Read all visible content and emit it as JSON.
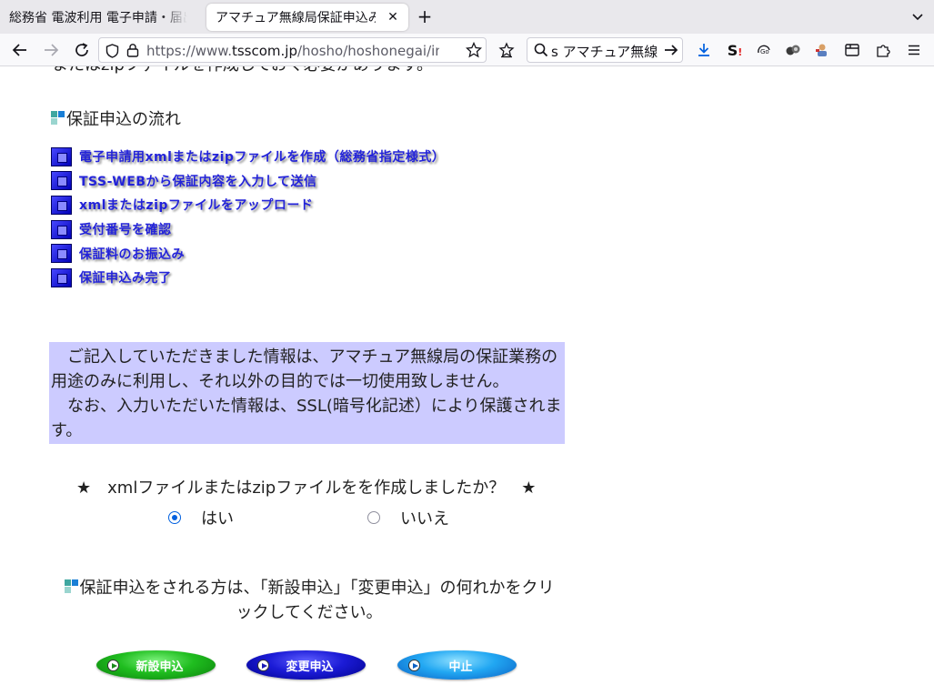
{
  "browser": {
    "tabs": [
      {
        "title": "総務省 電波利用 電子申請・届出システムLite",
        "active": false
      },
      {
        "title": "アマチュア無線局保証申込み",
        "active": true
      }
    ],
    "url": {
      "prefix": "https://www.",
      "host": "tsscom.jp",
      "path": "/hosho/hoshonegai/index.html"
    },
    "search_text": "s アマチュア無線"
  },
  "page": {
    "cut_top_text": "またはzipファイルを作成しておく必要があります。",
    "flow_heading": "保証申込の流れ",
    "flow_steps": [
      "電子申請用xmlまたはzipファイルを作成（総務省指定様式）",
      "TSS-WEBから保証内容を入力して送信",
      "xmlまたはzipファイルをアップロード",
      "受付番号を確認",
      "保証料のお振込み",
      "保証申込み完了"
    ],
    "notice_line1": "　ご記入していただきました情報は、アマチュア無線局の保証業務の用途のみに利用し、それ以外の目的では一切使用致しません。",
    "notice_line2": "　なお、入力いただいた情報は、SSL(暗号化記述）により保護されます。",
    "question": "★　xmlファイルまたはzipファイルをを作成しましたか？　★",
    "radio_yes": "はい",
    "radio_no": "いいえ",
    "radio_selected": "はい",
    "instruction": "保証申込をされる方は、「新設申込」「変更申込」の何れかをクリックしてください。",
    "buttons": {
      "new": "新設申込",
      "change": "変更申込",
      "stop": "中止"
    }
  },
  "colors": {
    "notice_bg": "#cccbff",
    "link": "#2323d9",
    "new_button": "#1fbd1f",
    "change_button": "#1b1bd6",
    "stop_button": "#21a7f2"
  }
}
